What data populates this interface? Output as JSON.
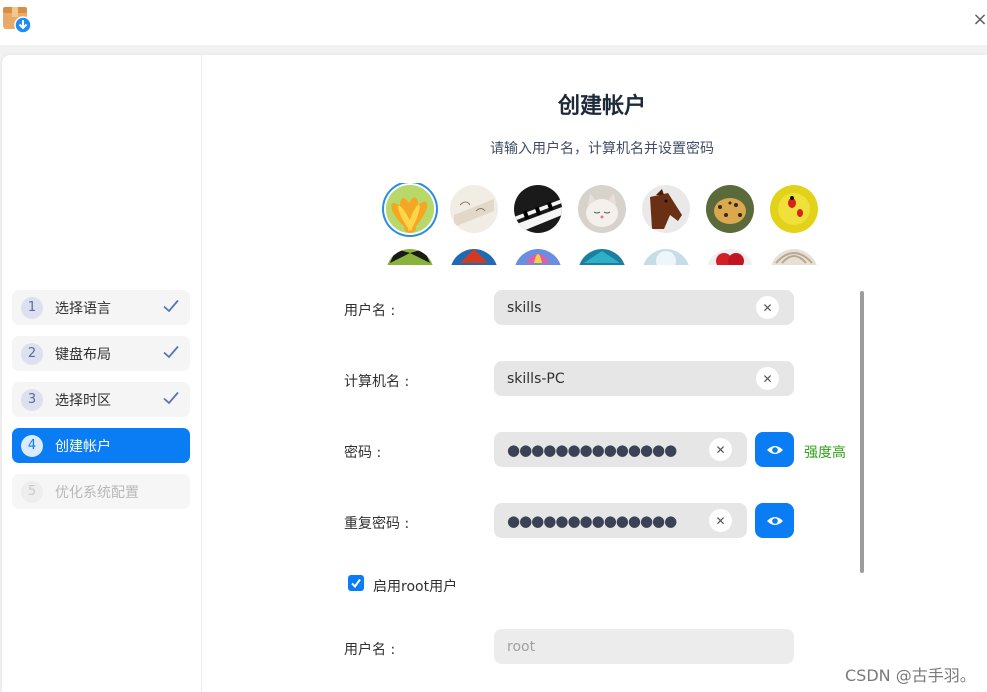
{
  "window": {
    "close_symbol": "×",
    "app_icon": "installer-box-download-icon"
  },
  "sidebar": {
    "steps": [
      {
        "num": "1",
        "label": "选择语言",
        "state": "done"
      },
      {
        "num": "2",
        "label": "键盘布局",
        "state": "done"
      },
      {
        "num": "3",
        "label": "选择时区",
        "state": "done"
      },
      {
        "num": "4",
        "label": "创建帐户",
        "state": "active"
      },
      {
        "num": "5",
        "label": "优化系统配置",
        "state": "disabled"
      }
    ]
  },
  "main": {
    "title": "创建帐户",
    "subtitle": "请输入用户名，计算机名并设置密码",
    "avatars": [
      "flower",
      "paper-shells",
      "piano-keys",
      "kitten",
      "horse",
      "leopard",
      "ladybug",
      "butterfly",
      "parrot",
      "hot-air-balloon",
      "beach",
      "snowy-tree",
      "berries",
      "shell"
    ],
    "selected_avatar": "flower",
    "form": {
      "username_label": "用户名 :",
      "username_value": "skills",
      "hostname_label": "计算机名 :",
      "hostname_value": "skills-PC",
      "password_label": "密码 :",
      "password_value": "●●●●●●●●●●●●●●",
      "password_strength": "强度高",
      "repeat_label": "重复密码 :",
      "repeat_value": "●●●●●●●●●●●●●●",
      "root_checkbox_label": "启用root用户",
      "root_checked": true,
      "root_username_label": "用户名 :",
      "root_username_placeholder": "root"
    }
  },
  "colors": {
    "accent": "#0a7cf4",
    "strength": "#30a215",
    "title": "#1d2a3a"
  },
  "watermark": "CSDN @古手羽。"
}
